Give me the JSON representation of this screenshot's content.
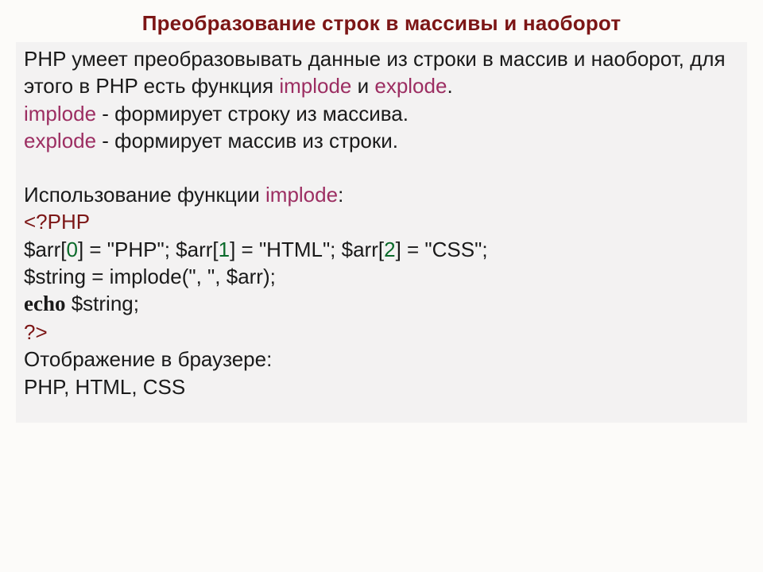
{
  "title": "Преобразование строк в массивы и наоборот",
  "para1": {
    "t1": "PHP умеет преобразовывать данные из строки в массив и наоборот, для этого в PHP есть функция ",
    "fn1": "implode",
    "and": " и ",
    "fn2": "explode",
    "dot": "."
  },
  "def1": {
    "fn": "implode",
    "rest": " - формирует строку из массива."
  },
  "def2": {
    "fn": "explode",
    "rest": " - формирует массив из строки."
  },
  "usage": {
    "t": "Использование функции ",
    "fn": "implode",
    "colon": ":"
  },
  "code": {
    "open": "<?PHP",
    "line1": {
      "a": "$arr[",
      "i0": "0",
      "b": "] = \"PHP\"; $arr[",
      "i1": "1",
      "c": "] = \"HTML\"; $arr[",
      "i2": "2",
      "d": "] = \"CSS\";"
    },
    "line2": "$string = implode(\", \", $arr);",
    "echo_kw": "echo",
    "echo_rest": " $string;",
    "close": "?>"
  },
  "out": {
    "label": "Отображение в браузере:",
    "result": "PHP,  HTML,  CSS"
  }
}
